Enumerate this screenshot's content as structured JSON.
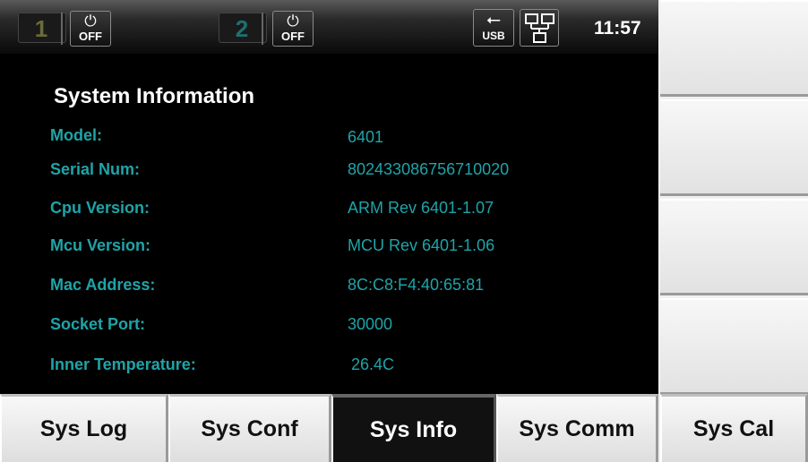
{
  "status_bar": {
    "channel1": {
      "number": "1",
      "power_symbol": "⏻",
      "power_label": "OFF"
    },
    "channel2": {
      "number": "2",
      "power_symbol": "⏻",
      "power_label": "OFF"
    },
    "usb": {
      "label": "USB",
      "icon": "usb-icon"
    },
    "lan": {
      "icon": "network-icon"
    },
    "time": "11:57"
  },
  "info": {
    "title": "System Information",
    "rows": [
      {
        "label": "Model:",
        "value": "6401"
      },
      {
        "label": "Serial Num:",
        "value": "802433086756710020"
      },
      {
        "label": "Cpu Version:",
        "value": "ARM Rev 6401-1.07"
      },
      {
        "label": "Mcu Version:",
        "value": "MCU Rev 6401-1.06"
      },
      {
        "label": "Mac Address:",
        "value": "8C:C8:F4:40:65:81"
      },
      {
        "label": "Socket Port:",
        "value": "30000"
      },
      {
        "label": "Inner Temperature:",
        "value": "26.4C"
      }
    ]
  },
  "tabs": [
    {
      "label": "Sys Log",
      "active": false
    },
    {
      "label": "Sys Conf",
      "active": false
    },
    {
      "label": "Sys Info",
      "active": true
    },
    {
      "label": "Sys Comm",
      "active": false
    },
    {
      "label": "Sys Cal",
      "active": false
    }
  ],
  "colors": {
    "accent_cyan": "#1fa4a8",
    "screen_bg": "#000000",
    "softkey_bg": "#e8e8e8"
  }
}
